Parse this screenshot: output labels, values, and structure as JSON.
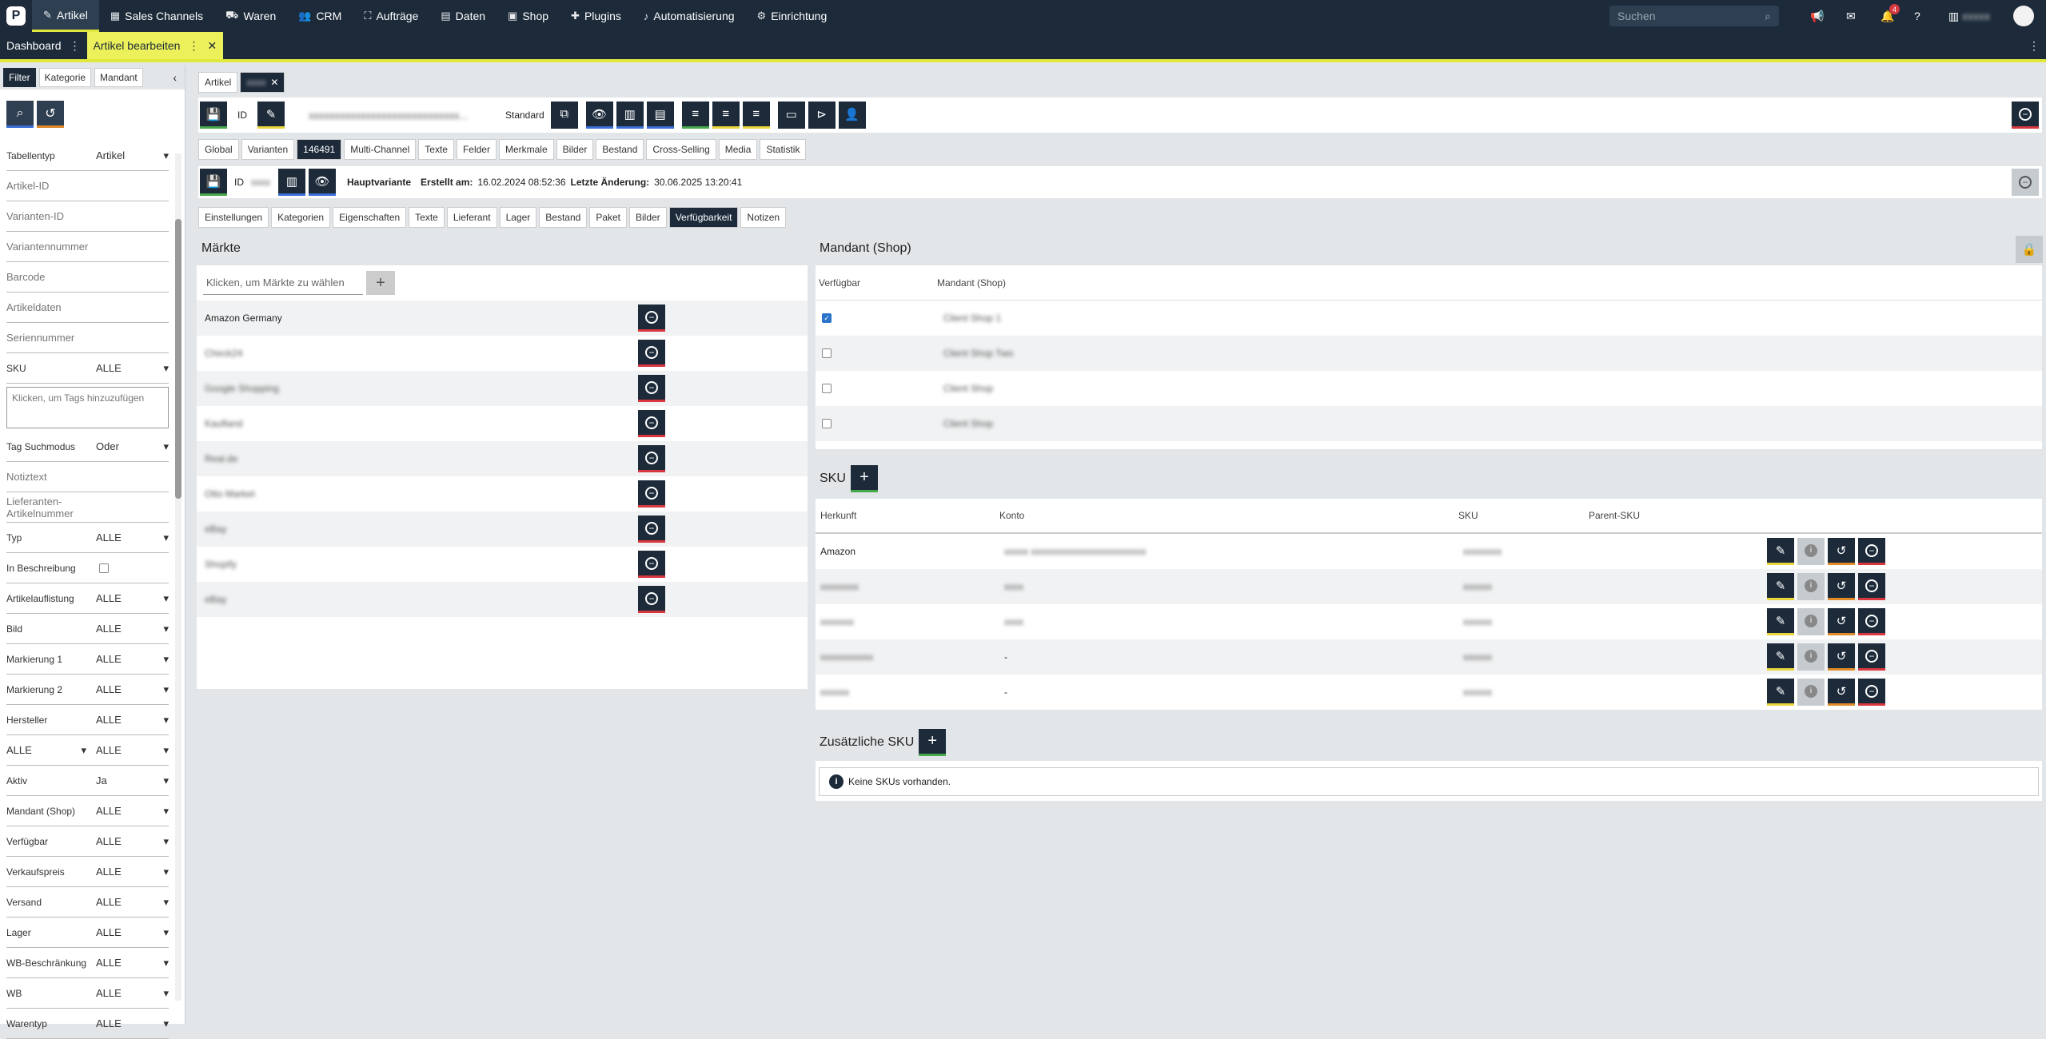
{
  "nav": {
    "logo": "P",
    "items": [
      {
        "label": "Artikel",
        "icon": "tag-icon"
      },
      {
        "label": "Sales Channels",
        "icon": "shop-icon"
      },
      {
        "label": "Waren",
        "icon": "truck-icon"
      },
      {
        "label": "CRM",
        "icon": "users-icon"
      },
      {
        "label": "Aufträge",
        "icon": "cart-icon"
      },
      {
        "label": "Daten",
        "icon": "database-icon"
      },
      {
        "label": "Shop",
        "icon": "store-icon"
      },
      {
        "label": "Plugins",
        "icon": "puzzle-icon"
      },
      {
        "label": "Automatisierung",
        "icon": "flow-icon"
      },
      {
        "label": "Einrichtung",
        "icon": "gear-icon"
      }
    ],
    "search_placeholder": "Suchen",
    "notification_count": "4"
  },
  "window_tabs": {
    "dashboard": "Dashboard",
    "article_edit": "Artikel bearbeiten"
  },
  "filter": {
    "tabs": [
      "Filter",
      "Kategorie",
      "Mandant"
    ],
    "rows": [
      {
        "label": "Tabellentyp",
        "value": "Artikel",
        "type": "select"
      },
      {
        "label": "Artikel-ID",
        "type": "input"
      },
      {
        "label": "Varianten-ID",
        "type": "input"
      },
      {
        "label": "Variantennummer",
        "type": "input"
      },
      {
        "label": "Barcode",
        "type": "input"
      },
      {
        "label": "Artikeldaten",
        "type": "input"
      },
      {
        "label": "Seriennummer",
        "type": "input"
      },
      {
        "label": "SKU",
        "value": "ALLE",
        "type": "select"
      },
      {
        "label": "Klicken, um Tags hinzuzufügen",
        "type": "tags"
      },
      {
        "label": "Tag Suchmodus",
        "value": "Oder",
        "type": "select"
      },
      {
        "label": "Notiztext",
        "type": "input"
      },
      {
        "label": "Lieferanten-Artikelnummer",
        "type": "input"
      },
      {
        "label": "Typ",
        "value": "ALLE",
        "type": "select"
      },
      {
        "label": "In Beschreibung",
        "type": "check"
      },
      {
        "label": "Artikelauflistung",
        "value": "ALLE",
        "type": "select"
      },
      {
        "label": "Bild",
        "value": "ALLE",
        "type": "select"
      },
      {
        "label": "Markierung 1",
        "value": "ALLE",
        "type": "select"
      },
      {
        "label": "Markierung 2",
        "value": "ALLE",
        "type": "select"
      },
      {
        "label": "Hersteller",
        "value": "ALLE",
        "type": "select"
      },
      {
        "label": "ALLE",
        "value": "ALLE",
        "type": "select2"
      },
      {
        "label": "Aktiv",
        "value": "Ja",
        "type": "select"
      },
      {
        "label": "Mandant (Shop)",
        "value": "ALLE",
        "type": "select"
      },
      {
        "label": "Verfügbar",
        "value": "ALLE",
        "type": "select"
      },
      {
        "label": "Verkaufspreis",
        "value": "ALLE",
        "type": "select"
      },
      {
        "label": "Versand",
        "value": "ALLE",
        "type": "select"
      },
      {
        "label": "Lager",
        "value": "ALLE",
        "type": "select"
      },
      {
        "label": "WB-Beschränkung",
        "value": "ALLE",
        "type": "select"
      },
      {
        "label": "WB",
        "value": "ALLE",
        "type": "select"
      },
      {
        "label": "Warentyp",
        "value": "ALLE",
        "type": "select"
      }
    ]
  },
  "article": {
    "breadcrumb": "Artikel",
    "id_label": "ID",
    "standard_label": "Standard",
    "tabs": [
      "Global",
      "Varianten",
      "146491",
      "Multi-Channel",
      "Texte",
      "Felder",
      "Merkmale",
      "Bilder",
      "Bestand",
      "Cross-Selling",
      "Media",
      "Statistik"
    ],
    "active_tab": "146491"
  },
  "variant": {
    "id_label": "ID",
    "main_variant": "Hauptvariante",
    "created_label": "Erstellt am:",
    "created_value": "16.02.2024 08:52:36",
    "changed_label": "Letzte Änderung:",
    "changed_value": "30.06.2025 13:20:41",
    "tabs": [
      "Einstellungen",
      "Kategorien",
      "Eigenschaften",
      "Texte",
      "Lieferant",
      "Lager",
      "Bestand",
      "Paket",
      "Bilder",
      "Verfügbarkeit",
      "Notizen"
    ],
    "active_tab": "Verfügbarkeit"
  },
  "markets": {
    "title": "Märkte",
    "placeholder": "Klicken, um Märkte zu wählen",
    "rows": [
      "Amazon Germany",
      "Check24",
      "Google Shopping",
      "Kaufland",
      "Real.de",
      "Otto Market",
      "eBay",
      "Shopify",
      "eBay"
    ]
  },
  "clients": {
    "title": "Mandant (Shop)",
    "col_available": "Verfügbar",
    "col_client": "Mandant (Shop)",
    "rows": [
      {
        "checked": true,
        "name": "Client Shop 1"
      },
      {
        "checked": false,
        "name": "Client Shop Two"
      },
      {
        "checked": false,
        "name": "Client Shop"
      },
      {
        "checked": false,
        "name": "Client Shop"
      }
    ]
  },
  "sku": {
    "title": "SKU",
    "cols": [
      "Herkunft",
      "Konto",
      "SKU",
      "Parent-SKU"
    ],
    "rows": [
      {
        "origin": "Amazon",
        "account": "xxxxx xxxxxxxxxxxxxxxxxxxxxxxx",
        "sku": "xxxxxxxx"
      },
      {
        "origin": "xxxxxxxx",
        "account": "xxxx",
        "sku": "xxxxxx"
      },
      {
        "origin": "xxxxxxx",
        "account": "xxxx",
        "sku": "xxxxxx"
      },
      {
        "origin": "xxxxxxxxxxx",
        "account": "-",
        "sku": "xxxxxx"
      },
      {
        "origin": "xxxxxx",
        "account": "-",
        "sku": "xxxxxx"
      }
    ]
  },
  "extra_sku": {
    "title": "Zusätzliche SKU",
    "empty": "Keine SKUs vorhanden."
  }
}
